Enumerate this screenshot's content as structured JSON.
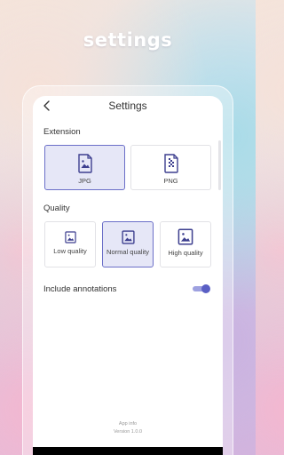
{
  "hero": {
    "title": "settings"
  },
  "app_bar": {
    "title": "Settings",
    "back_icon": "chevron-left-icon"
  },
  "extension": {
    "title": "Extension",
    "options": [
      {
        "label": "JPG",
        "icon": "image-file-icon",
        "selected": true
      },
      {
        "label": "PNG",
        "icon": "zip-file-icon",
        "selected": false
      }
    ]
  },
  "quality": {
    "title": "Quality",
    "options": [
      {
        "label": "Low quality",
        "icon": "image-icon-small",
        "selected": false
      },
      {
        "label": "Normal quality",
        "icon": "image-icon-medium",
        "selected": true
      },
      {
        "label": "High quality",
        "icon": "image-icon-large",
        "selected": false
      }
    ]
  },
  "annotations": {
    "label": "Include annotations",
    "enabled": true
  },
  "footer": {
    "app_info": "App info",
    "version": "Version 1.0.0"
  },
  "colors": {
    "accent": "#5a5fc4",
    "selected_bg": "#e6e7f7",
    "selected_border": "#6b6fc8",
    "toggle_track": "#9ea1e0"
  }
}
